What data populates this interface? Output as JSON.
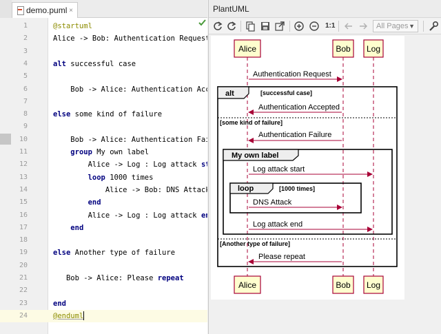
{
  "editor": {
    "tab_label": "demo.puml",
    "tab_close": "×",
    "lines": [
      {
        "n": "1",
        "parts": [
          {
            "t": "@startuml",
            "c": "tg"
          }
        ]
      },
      {
        "n": "2",
        "parts": [
          {
            "t": "Alice -> Bob: Authentication Request",
            "c": ""
          }
        ]
      },
      {
        "n": "3",
        "parts": []
      },
      {
        "n": "4",
        "parts": [
          {
            "t": "alt",
            "c": "kw"
          },
          {
            "t": " successful case",
            "c": ""
          }
        ]
      },
      {
        "n": "5",
        "parts": []
      },
      {
        "n": "6",
        "parts": [
          {
            "t": "    Bob -> Alice: Authentication Accepte",
            "c": ""
          }
        ]
      },
      {
        "n": "7",
        "parts": []
      },
      {
        "n": "8",
        "parts": [
          {
            "t": "else",
            "c": "kw"
          },
          {
            "t": " some kind of failure",
            "c": ""
          }
        ]
      },
      {
        "n": "9",
        "parts": []
      },
      {
        "n": "10",
        "parts": [
          {
            "t": "    Bob -> Alice: Authentication Failure",
            "c": ""
          }
        ]
      },
      {
        "n": "11",
        "parts": [
          {
            "t": "    ",
            "c": ""
          },
          {
            "t": "group",
            "c": "kw"
          },
          {
            "t": " My own label",
            "c": ""
          }
        ]
      },
      {
        "n": "12",
        "parts": [
          {
            "t": "        Alice -> Log : Log attack ",
            "c": ""
          },
          {
            "t": "star",
            "c": "kw"
          }
        ]
      },
      {
        "n": "13",
        "parts": [
          {
            "t": "        ",
            "c": ""
          },
          {
            "t": "loop",
            "c": "kw"
          },
          {
            "t": " 1000 times",
            "c": ""
          }
        ]
      },
      {
        "n": "14",
        "parts": [
          {
            "t": "            Alice -> Bob: DNS Attack",
            "c": ""
          }
        ]
      },
      {
        "n": "15",
        "parts": [
          {
            "t": "        ",
            "c": ""
          },
          {
            "t": "end",
            "c": "kw"
          }
        ]
      },
      {
        "n": "16",
        "parts": [
          {
            "t": "        Alice -> Log : Log attack ",
            "c": ""
          },
          {
            "t": "end",
            "c": "kw"
          }
        ]
      },
      {
        "n": "17",
        "parts": [
          {
            "t": "    ",
            "c": ""
          },
          {
            "t": "end",
            "c": "kw"
          }
        ]
      },
      {
        "n": "18",
        "parts": []
      },
      {
        "n": "19",
        "parts": [
          {
            "t": "else",
            "c": "kw"
          },
          {
            "t": " Another type of failure",
            "c": ""
          }
        ]
      },
      {
        "n": "20",
        "parts": []
      },
      {
        "n": "21",
        "parts": [
          {
            "t": "   Bob -> Alice: Please ",
            "c": ""
          },
          {
            "t": "repeat",
            "c": "kw"
          }
        ]
      },
      {
        "n": "22",
        "parts": []
      },
      {
        "n": "23",
        "parts": [
          {
            "t": "end",
            "c": "kw"
          }
        ]
      },
      {
        "n": "24",
        "parts": [
          {
            "t": "@enduml",
            "c": "tg ul"
          }
        ]
      }
    ]
  },
  "preview": {
    "title": "PlantUML",
    "toolbar": {
      "zoom_actual_label": "1:1",
      "page_select_value": "All Pages",
      "icons": [
        "refresh-icon",
        "refresh-all-icon",
        "copy-icon",
        "save-icon",
        "open-external-icon",
        "zoom-in-icon",
        "zoom-out-icon",
        "back-arrow-icon",
        "forward-arrow-icon",
        "settings-wrench-icon"
      ]
    }
  },
  "diagram": {
    "participants": [
      "Alice",
      "Bob",
      "Log"
    ],
    "fragments": {
      "alt": {
        "keyword": "alt",
        "conditions": [
          "[successful case]",
          "[some kind of failure]",
          "[Another type of failure]"
        ]
      },
      "group": {
        "keyword": "My own label"
      },
      "loop": {
        "keyword": "loop",
        "condition": "[1000 times]"
      }
    },
    "messages": [
      "Authentication Request",
      "Authentication Accepted",
      "Authentication Failure",
      "Log attack start",
      "DNS Attack",
      "Log attack end",
      "Please repeat"
    ]
  },
  "colors": {
    "arrow": "#a80036",
    "participant_fill": "#fefece",
    "participant_border": "#a80036"
  }
}
